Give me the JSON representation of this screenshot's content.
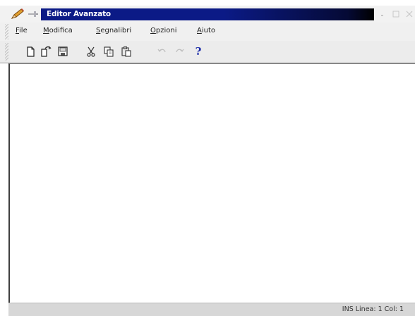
{
  "window": {
    "title": "Editor Avanzato"
  },
  "menu": {
    "items": [
      {
        "mnemonic": "F",
        "rest": "ile"
      },
      {
        "mnemonic": "M",
        "rest": "odifica"
      },
      {
        "mnemonic": "S",
        "rest": "egnalibri"
      },
      {
        "mnemonic": "O",
        "rest": "pzioni"
      },
      {
        "mnemonic": "A",
        "rest": "iuto"
      }
    ]
  },
  "toolbar": {
    "help_label": "?",
    "icons": [
      "new-file-icon",
      "open-file-icon",
      "save-icon",
      "cut-icon",
      "copy-icon",
      "paste-icon",
      "undo-icon",
      "redo-icon",
      "help-icon"
    ]
  },
  "editor": {
    "content": ""
  },
  "statusbar": {
    "text": "INS  Linea: 1  Col: 1"
  },
  "colors": {
    "title_bar": "#0b1a86",
    "help_icon": "#1a2aa8"
  }
}
